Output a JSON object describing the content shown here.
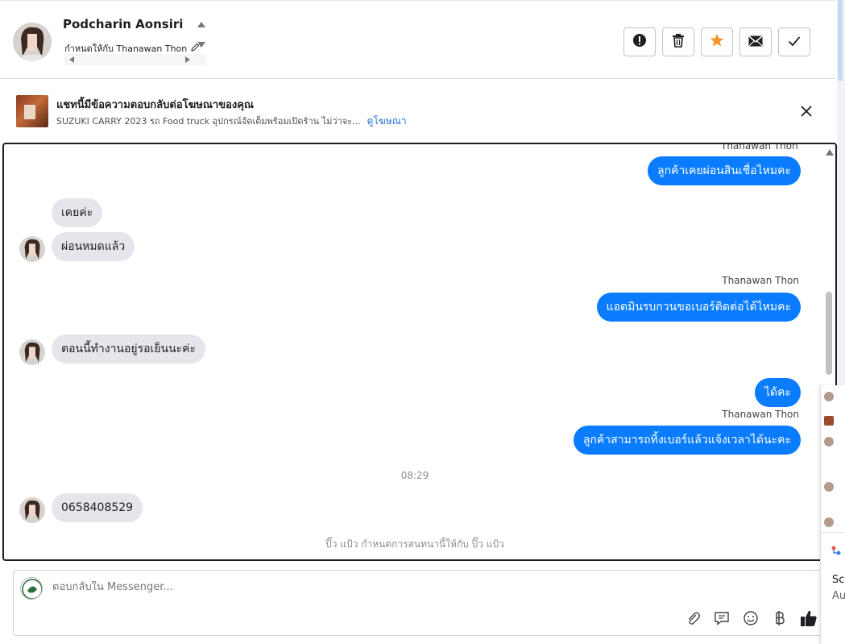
{
  "header": {
    "customer_name": "Podcharin Aonsiri",
    "assigned_label": "กำหนดให้กับ Thanawan Thon",
    "actions": [
      {
        "name": "spam-button",
        "icon": "exclamation-icon"
      },
      {
        "name": "delete-button",
        "icon": "trash-icon"
      },
      {
        "name": "star-button",
        "icon": "star-icon"
      },
      {
        "name": "unread-button",
        "icon": "envelope-icon"
      },
      {
        "name": "done-button",
        "icon": "check-icon"
      }
    ]
  },
  "ad_banner": {
    "title": "แชทนี้มีข้อความตอบกลับต่อโฆษณาของคุณ",
    "subtitle": "SUZUKI CARRY 2023 รถ Food truck อุปกรณ์จัดเต็มพร้อมเปิดร้าน ไม่ว่าจะ...",
    "link": "ดูโฆษณา"
  },
  "conversation": {
    "messages": [
      {
        "direction": "out",
        "sender": "Thanawan Thon",
        "text": "ลูกค้าเคยผ่อนสินเชื่อไหมคะ"
      },
      {
        "direction": "in",
        "text": "เคยค่ะ"
      },
      {
        "direction": "in",
        "text": "ผ่อนหมดแล้ว"
      },
      {
        "direction": "out",
        "sender": "Thanawan Thon",
        "text": "แอดมินรบกวนขอเบอร์ติดต่อได้ไหมคะ"
      },
      {
        "direction": "in",
        "text": "ตอนนี้ทำงานอยู่รอเย็นนะค่ะ"
      },
      {
        "direction": "out",
        "text": "ได้คะ"
      },
      {
        "direction": "out",
        "sender": "Thanawan Thon",
        "text": "ลูกค้าสามารถทิ้งเบอร์แล้วแจ้งเวลาได้นะคะ"
      },
      {
        "direction": "in",
        "text": "0658408529"
      }
    ],
    "time_divider": "08:29",
    "assignment_note": "ปิ๊ว แป้ว กำหนดการสนทนานี้ให้กับ ปิ๊ว แป้ว"
  },
  "composer": {
    "placeholder": "ตอบกลับใน Messenger...",
    "tools": [
      "paperclip-icon",
      "saved-reply-icon",
      "emoji-icon",
      "baht-icon",
      "thumbs-up-icon"
    ]
  },
  "right_edge": {
    "label1": "Scr",
    "label2": "Au"
  },
  "colors": {
    "outgoing_bubble": "#0a7cff",
    "incoming_bubble": "#e4e6eb",
    "link": "#216fdb",
    "star": "#f0962a"
  }
}
